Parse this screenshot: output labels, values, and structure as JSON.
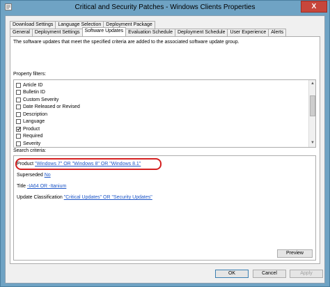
{
  "window": {
    "title": "Critical and Security Patches - Windows Clients Properties",
    "close_glyph": "X"
  },
  "tabs": {
    "row1": [
      "Download Settings",
      "Language Selection",
      "Deployment Package"
    ],
    "row2": [
      "General",
      "Deployment Settings",
      "Software Updates",
      "Evaluation Schedule",
      "Deployment Schedule",
      "User Experience",
      "Alerts"
    ],
    "active": "Software Updates"
  },
  "panel": {
    "description": "The software updates that meet the specified criteria are added to the associated software update group.",
    "property_filters_label": "Property filters:",
    "search_criteria_label": "Search criteria:",
    "filters": [
      {
        "label": "Article ID",
        "checked": false
      },
      {
        "label": "Bulletin ID",
        "checked": false
      },
      {
        "label": "Custom Severity",
        "checked": false
      },
      {
        "label": "Date Released or Revised",
        "checked": false
      },
      {
        "label": "Description",
        "checked": false
      },
      {
        "label": "Language",
        "checked": false
      },
      {
        "label": "Product",
        "checked": true
      },
      {
        "label": "Required",
        "checked": false
      },
      {
        "label": "Severity",
        "checked": false
      }
    ],
    "criteria": [
      {
        "prefix": "Product ",
        "value": "\"Windows 7\" OR \"Windows 8\" OR \"Windows 8.1\""
      },
      {
        "prefix": "Superseded ",
        "value": "No"
      },
      {
        "prefix": "Title ",
        "value": "-IA64 OR -Itanium"
      },
      {
        "prefix": "Update Classification ",
        "value": "\"Critical Updates\" OR \"Security Updates\""
      }
    ],
    "preview_label": "Preview"
  },
  "footer": {
    "ok_label": "OK",
    "cancel_label": "Cancel",
    "apply_label": "Apply"
  },
  "colors": {
    "title_bar": "#6fa3c4",
    "close_button": "#c7463b",
    "link": "#1c55c7",
    "highlight": "#d41f1f"
  }
}
